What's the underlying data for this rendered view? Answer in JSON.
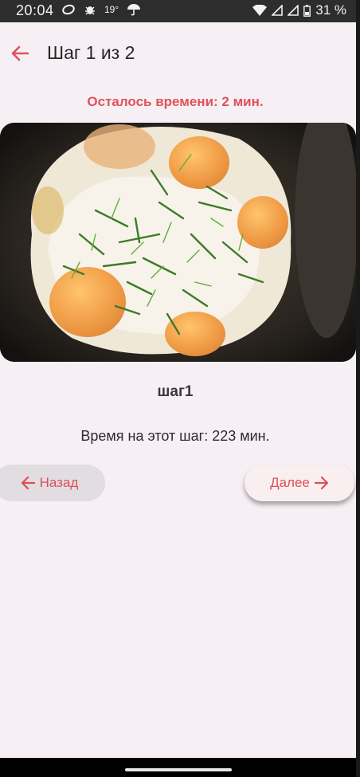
{
  "status_bar": {
    "time": "20:04",
    "temperature": "19°",
    "battery": "31 %"
  },
  "app_bar": {
    "title": "Шаг 1 из 2",
    "back_icon": "arrow-left-icon"
  },
  "timer_text": "Осталось времени: 2 мин.",
  "step": {
    "title": "шаг1",
    "time_text": "Время на этот шаг: 223 мин."
  },
  "buttons": {
    "back_label": "Назад",
    "next_label": "Далее"
  },
  "colors": {
    "accent": "#e0525a",
    "background": "#f6eff4",
    "status_bar": "#2d2d2d"
  }
}
